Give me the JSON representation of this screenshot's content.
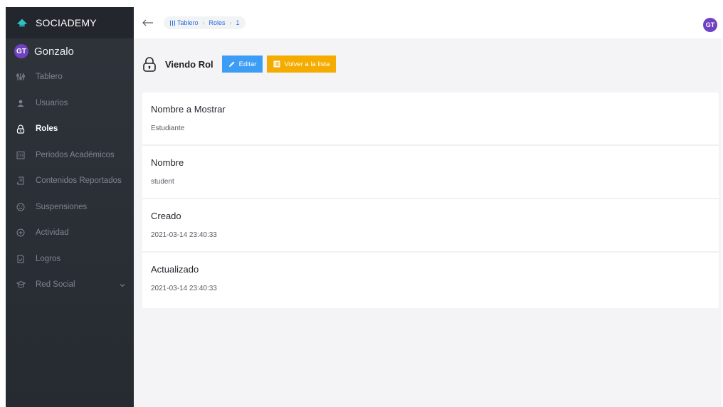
{
  "brand": {
    "name": "SOCIADEMY"
  },
  "user": {
    "initials": "GT",
    "name": "Gonzalo"
  },
  "sidebar": {
    "items": [
      {
        "label": "Tablero",
        "icon": "dashboard-icon"
      },
      {
        "label": "Usuarios",
        "icon": "user-icon"
      },
      {
        "label": "Roles",
        "icon": "lock-icon",
        "active": true
      },
      {
        "label": "Periodos Académicos",
        "icon": "calendar-icon"
      },
      {
        "label": "Contenidos Reportados",
        "icon": "report-icon"
      },
      {
        "label": "Suspensiones",
        "icon": "sad-face-icon"
      },
      {
        "label": "Actividad",
        "icon": "plus-circle-icon"
      },
      {
        "label": "Logros",
        "icon": "achievement-icon"
      },
      {
        "label": "Red Social",
        "icon": "graduation-cap-icon",
        "has_submenu": true
      }
    ]
  },
  "breadcrumb": {
    "home": "Tablero",
    "section": "Roles",
    "current": "1"
  },
  "top_avatar": {
    "initials": "GT"
  },
  "page": {
    "title": "Viendo Rol",
    "edit_label": "Editar",
    "back_label": "Volver a la lista"
  },
  "fields": [
    {
      "label": "Nombre a Mostrar",
      "value": "Estudiante"
    },
    {
      "label": "Nombre",
      "value": "student"
    },
    {
      "label": "Creado",
      "value": "2021-03-14 23:40:33"
    },
    {
      "label": "Actualizado",
      "value": "2021-03-14 23:40:33"
    }
  ],
  "colors": {
    "sidebar_bg": "#2f343b",
    "accent_purple": "#6f42c1",
    "edit_blue": "#3d9df5",
    "back_orange": "#f5ac00",
    "brand_teal": "#2ec4c4"
  }
}
